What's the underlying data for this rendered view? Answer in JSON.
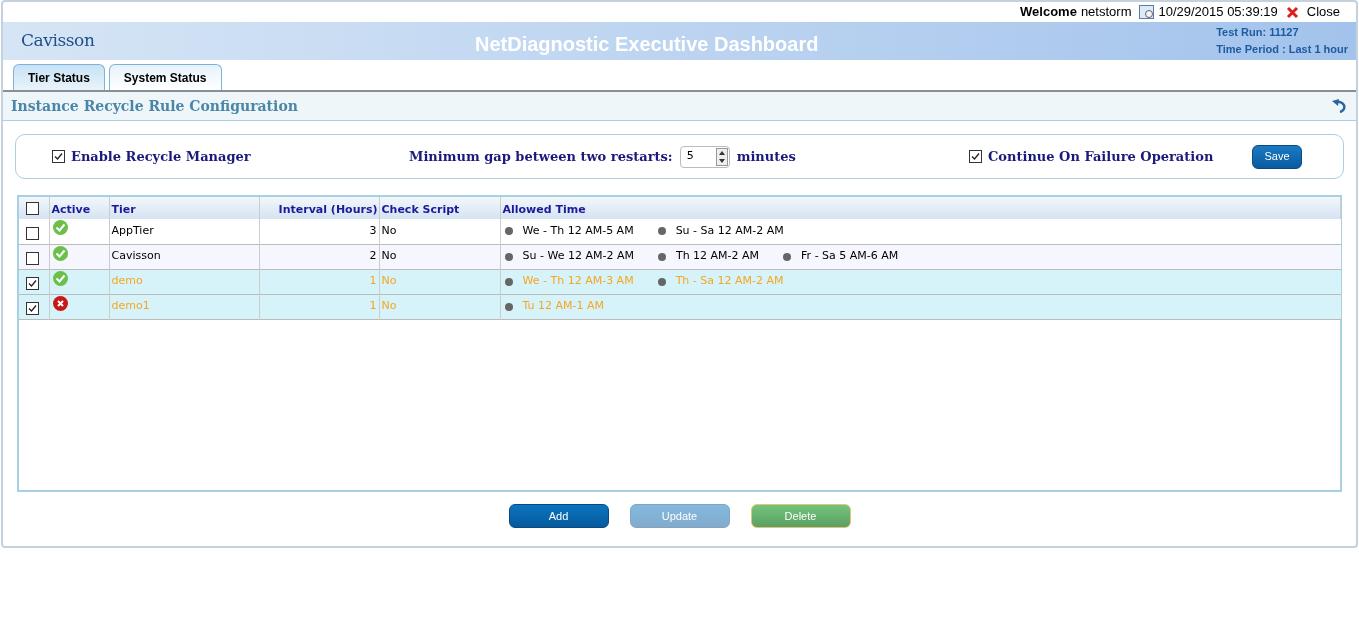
{
  "topbar": {
    "welcome": "Welcome",
    "user": "netstorm",
    "datetime": "10/29/2015 05:39:19",
    "close": "Close"
  },
  "header": {
    "logo": "Cavisson",
    "title": "NetDiagnostic Executive Dashboard",
    "test_run": "Test Run: 11127",
    "time_period": "Time Period : Last 1 hour"
  },
  "tabs": [
    {
      "label": "Tier Status",
      "selected": true
    },
    {
      "label": "System Status",
      "selected": false
    }
  ],
  "panel": {
    "title": "Instance Recycle Rule Configuration"
  },
  "settings": {
    "enable_recycle": {
      "label": "Enable Recycle Manager",
      "checked": true
    },
    "min_gap": {
      "label": "Minimum gap between two restarts:",
      "value": "5",
      "unit": "minutes"
    },
    "continue_on_failure": {
      "label": "Continue On Failure Operation",
      "checked": true
    },
    "save": "Save"
  },
  "table": {
    "header_checked": false,
    "columns": [
      "Active",
      "Tier",
      "Interval (Hours)",
      "Check Script",
      "Allowed Time"
    ],
    "rows": [
      {
        "checked": false,
        "active": true,
        "tier": "AppTier",
        "interval": "3",
        "check_script": "No",
        "allowed": [
          "We - Th 12 AM-5 AM",
          "Su - Sa 12 AM-2 AM"
        ]
      },
      {
        "checked": false,
        "active": true,
        "tier": "Cavisson",
        "interval": "2",
        "check_script": "No",
        "allowed": [
          "Su - We 12 AM-2 AM",
          "Th 12 AM-2 AM",
          "Fr - Sa 5 AM-6 AM"
        ]
      },
      {
        "checked": true,
        "active": true,
        "tier": "demo",
        "interval": "1",
        "check_script": "No",
        "allowed": [
          "We - Th 12 AM-3 AM",
          "Th - Sa 12 AM-2 AM"
        ]
      },
      {
        "checked": true,
        "active": false,
        "tier": "demo1",
        "interval": "1",
        "check_script": "No",
        "allowed": [
          "Tu 12 AM-1 AM"
        ]
      }
    ]
  },
  "buttons": [
    {
      "label": "Add",
      "kind": "primary",
      "disabled": false
    },
    {
      "label": "Update",
      "kind": "primary",
      "disabled": true
    },
    {
      "label": "Delete",
      "kind": "danger",
      "disabled": false
    }
  ]
}
